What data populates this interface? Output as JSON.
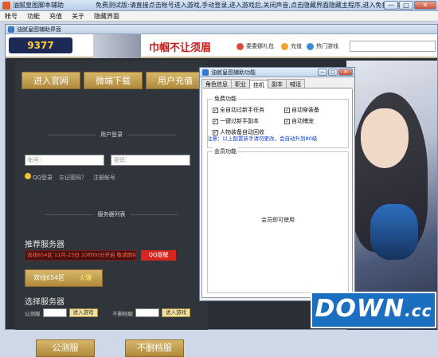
{
  "outer": {
    "title": "油腻皇图脚本辅助",
    "marquee": "免费测试版:请直接点击帐号进入游戏,手动登录,进入游戏后,关闭声音,点击隐藏界面隐藏主程序,进入免打扰模式!",
    "min": "—",
    "max": "□",
    "close": "✕"
  },
  "menu": [
    "帐号",
    "功能",
    "充值",
    "关于",
    "隐藏界面"
  ],
  "inner": {
    "title": "油腻皇图辅助界面"
  },
  "header": {
    "logo": "9377",
    "slogan": "巾帼不让须眉",
    "link1": "委委娜礼包",
    "link2": "充值",
    "link3": "热门游戏",
    "search_placeholder": ""
  },
  "game": {
    "btn_official": "进入官网",
    "btn_download": "微端下载",
    "btn_recharge": "用户充值",
    "login_section": "用户登录",
    "account_placeholder": "帐号：",
    "password_placeholder": "密码：",
    "qq_login": "QQ登录",
    "forgot": "忘记密码？",
    "register": "注册帐号",
    "server_section": "服务器列表",
    "recommended": "推荐服务器",
    "rec_strip": "双线654区  11月-23日 10时00分开启  敬请期待",
    "qq_remind": "QQ提醒",
    "server_name": "双线654区",
    "server_status": "火爆",
    "select_title": "选择服务器",
    "test_label": "公测服",
    "enter_btn": "进入游戏",
    "nodelete_label": "不删档服",
    "btn_test": "公测服",
    "btn_nodelete": "不删档服"
  },
  "helper": {
    "title": "油腻皇图辅助功能",
    "min": "—",
    "max": "□",
    "close": "✕",
    "tabs": [
      "角色信息",
      "职业",
      "挂机",
      "副本",
      "喊话"
    ],
    "free_group": "免费功能",
    "cb1": "全自动过新手任务",
    "cb2": "自动穿装备",
    "cb3": "一键过新手副本",
    "cb4": "自动捕宠",
    "cb5": "人物装备自动回收",
    "note": "注意：以上配置新手请勿更改，会自动升到80级",
    "vip_group": "会员功能",
    "vip_text": "会员即可使用"
  },
  "watermark": {
    "main": "DOWN",
    "suffix": ".cc"
  }
}
